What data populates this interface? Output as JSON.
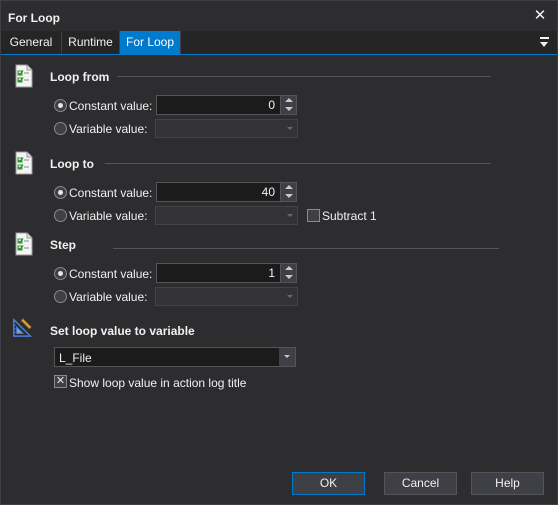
{
  "window": {
    "title": "For Loop",
    "close_glyph": "✕"
  },
  "tabs": [
    {
      "label": "General",
      "active": false
    },
    {
      "label": "Runtime",
      "active": false
    },
    {
      "label": "For Loop",
      "active": true
    }
  ],
  "loop_from": {
    "title": "Loop from",
    "constant_label": "Constant value:",
    "constant_value": "0",
    "variable_label": "Variable value:",
    "variable_value": "",
    "selected": "constant"
  },
  "loop_to": {
    "title": "Loop to",
    "constant_label": "Constant value:",
    "constant_value": "40",
    "variable_label": "Variable value:",
    "variable_value": "",
    "subtract_label": "Subtract 1",
    "subtract_checked": false,
    "selected": "constant"
  },
  "step": {
    "title": "Step",
    "constant_label": "Constant value:",
    "constant_value": "1",
    "variable_label": "Variable value:",
    "variable_value": "",
    "selected": "constant"
  },
  "set_loop": {
    "title": "Set loop value to variable",
    "variable": "L_File",
    "show_in_log_label": "Show loop value in action log title",
    "show_in_log_checked": true
  },
  "buttons": {
    "ok": "OK",
    "cancel": "Cancel",
    "help": "Help"
  },
  "colors": {
    "accent": "#007acc",
    "background": "#2d2d30",
    "field": "#1b1b1c"
  },
  "icons": {
    "section": "checklist-icon",
    "variable": "set-variable-icon"
  }
}
